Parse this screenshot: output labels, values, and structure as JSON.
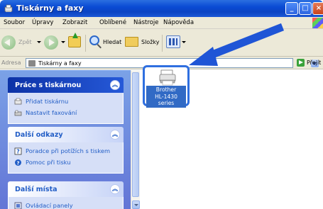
{
  "window": {
    "title": "Tiskárny a faxy"
  },
  "menu": [
    "Soubor",
    "Úpravy",
    "Zobrazit",
    "Oblíbené",
    "Nástroje",
    "Nápověda"
  ],
  "toolbar": {
    "back_label": "Zpět",
    "search_label": "Hledat",
    "folders_label": "Složky"
  },
  "address": {
    "label": "Adresa",
    "value": "Tiskárny a faxy",
    "go_label": "Přejít"
  },
  "panels": [
    {
      "title": "Práce s tiskárnou",
      "items": [
        "Přidat tiskárnu",
        "Nastavit faxování"
      ]
    },
    {
      "title": "Další odkazy",
      "items": [
        "Poradce při potížích s tiskem",
        "Pomoc při tisku"
      ]
    },
    {
      "title": "Další místa",
      "items": [
        "Ovládací panely"
      ]
    }
  ],
  "printer": {
    "name_line1": "Brother",
    "name_line2": "HL-1430 series"
  },
  "colors": {
    "title_bar": "#0a4bd4",
    "task_pane": "#7ba2e7",
    "selection": "#316ac5",
    "highlight_border": "#2f6fe0"
  }
}
